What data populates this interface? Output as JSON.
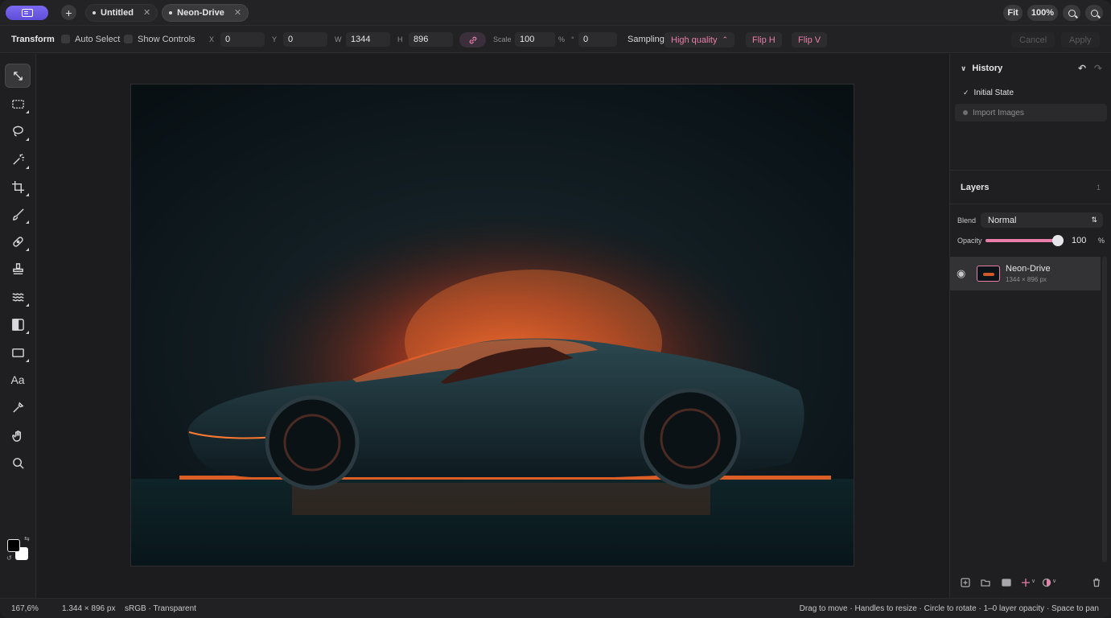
{
  "tabs": [
    {
      "label": "Untitled",
      "active": false
    },
    {
      "label": "Neon-Drive",
      "active": true
    }
  ],
  "topright": {
    "fit_label": "Fit",
    "zoom_label": "100%"
  },
  "options": {
    "tool_title": "Transform",
    "auto_select_label": "Auto Select",
    "show_controls_label": "Show Controls",
    "x_label": "X",
    "x_value": "0",
    "y_label": "Y",
    "y_value": "0",
    "w_label": "W",
    "w_value": "1344",
    "h_label": "H",
    "h_value": "896",
    "scale_label": "Scale",
    "scale_value": "100",
    "scale_unit": "%",
    "rotate_label": "°",
    "rotate_value": "0",
    "sampling_label": "Sampling",
    "sampling_value": "High quality",
    "flip_h_label": "Flip H",
    "flip_v_label": "Flip V",
    "cancel_label": "Cancel",
    "apply_label": "Apply"
  },
  "tools": [
    {
      "icon": "move-transform-icon"
    },
    {
      "icon": "marquee-select-icon"
    },
    {
      "icon": "lasso-icon"
    },
    {
      "icon": "magic-wand-icon"
    },
    {
      "icon": "crop-icon"
    },
    {
      "icon": "brush-icon"
    },
    {
      "icon": "healing-bandage-icon"
    },
    {
      "icon": "stamp-icon"
    },
    {
      "icon": "liquify-waves-icon"
    },
    {
      "icon": "gradient-icon"
    },
    {
      "icon": "rectangle-shape-icon"
    },
    {
      "icon": "text-tool-icon",
      "label": "Aa"
    },
    {
      "icon": "eyedropper-icon"
    },
    {
      "icon": "hand-pan-icon"
    },
    {
      "icon": "zoom-icon"
    }
  ],
  "colors": {
    "accent": "#e87ea9",
    "foreground": "#000000",
    "background": "#ffffff"
  },
  "history": {
    "title": "History",
    "items": [
      {
        "label": "Initial State",
        "selected": true
      },
      {
        "label": "Import Images",
        "selected": false
      }
    ]
  },
  "layers": {
    "title": "Layers",
    "count": "1",
    "blend_label": "Blend",
    "blend_value": "Normal",
    "opacity_label": "Opacity",
    "opacity_value": "100",
    "opacity_unit": "%",
    "opacity_fraction": 1.0,
    "items": [
      {
        "name": "Neon-Drive",
        "size": "1344 × 896 px",
        "visible": true
      }
    ]
  },
  "status": {
    "zoom": "167,6%",
    "dimensions": "1.344 × 896 px",
    "color_info": "sRGB · Transparent",
    "hint": "Drag to move · Handles to resize · Circle to rotate · 1–0 layer opacity · Space to pan"
  }
}
